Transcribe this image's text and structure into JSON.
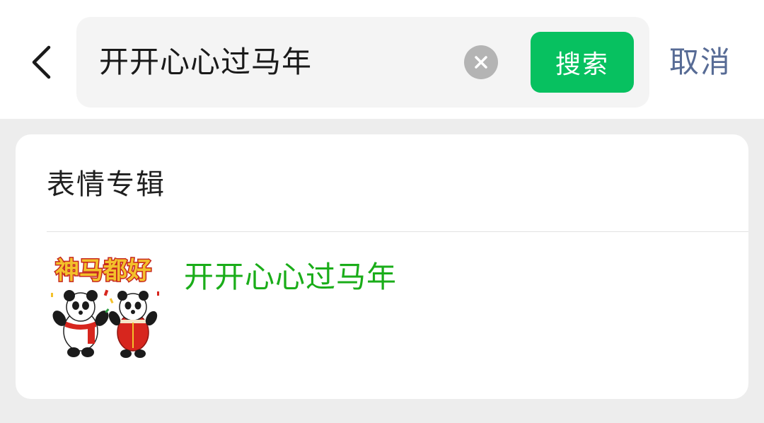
{
  "search": {
    "query": "开开心心过马年",
    "search_button": "搜索",
    "cancel": "取消"
  },
  "icons": {
    "back": "chevron-left-icon",
    "clear": "clear-circle-x-icon"
  },
  "section": {
    "title": "表情专辑"
  },
  "results": [
    {
      "title": "开开心心过马年",
      "thumbnail_caption": "神马都好"
    }
  ],
  "colors": {
    "brand_green": "#07c160",
    "result_green": "#1aad19",
    "link_blue": "#576b95",
    "background": "#ededed"
  }
}
